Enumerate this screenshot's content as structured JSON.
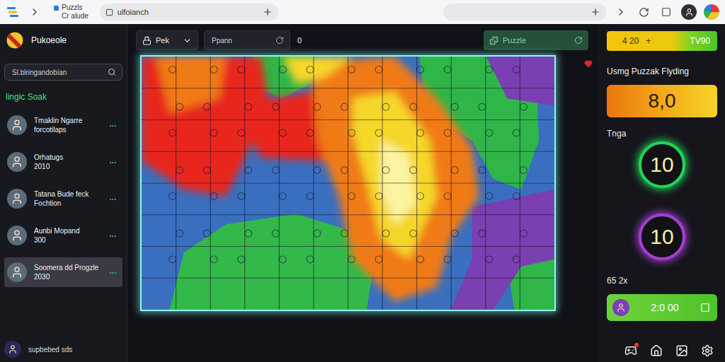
{
  "browser": {
    "tab": {
      "title": "Puzzls",
      "subtitle": "Cr alude"
    },
    "address": "ulfoianch"
  },
  "sidebar": {
    "app_name": "Pukoeole",
    "search": {
      "placeholder": "Sl.blringandobian"
    },
    "section": "lingic Soak",
    "items": [
      {
        "name": "Tmaklin Ngarre",
        "sub": "forcotilaps",
        "menu": "•••",
        "selected": false
      },
      {
        "name": "Orhatugs",
        "sub": "2010",
        "menu": "•••",
        "selected": false
      },
      {
        "name": "Tatana Bude feck",
        "sub": "Fochtion",
        "menu": "•••",
        "selected": false
      },
      {
        "name": "Aunbi Mopand",
        "sub": "300",
        "menu": "•••",
        "selected": false
      },
      {
        "name": "Soomera dd Progzle",
        "sub": "2030",
        "menu": "•••",
        "selected": true
      }
    ],
    "footer": "supbebed sds"
  },
  "toolbar": {
    "dropdown": "Pek",
    "search": {
      "placeholder": "Ppann"
    },
    "count": "0",
    "button": "Puzzle"
  },
  "stats": {
    "top_bar": {
      "left": "4 20",
      "sign": "+",
      "right": "TV90"
    },
    "title": "Usmg Puzzak Flyding",
    "score": "8,0",
    "label": "Tnga",
    "rings": [
      {
        "value": "10",
        "color": "#1fd65a"
      },
      {
        "value": "10",
        "color": "#a43fd0"
      }
    ],
    "multiplier": "65 2x",
    "timer": "2:0 00"
  }
}
